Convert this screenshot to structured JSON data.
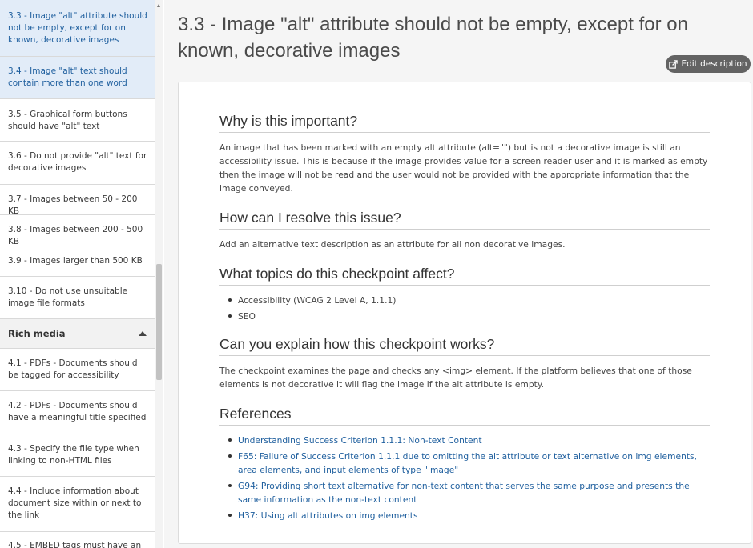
{
  "sidebar": {
    "items_top": [
      {
        "label": "3.3 - Image \"alt\" attribute should not be empty, except for on known, decorative images",
        "active": true
      },
      {
        "label": "3.4 - Image \"alt\" text should contain more than one word",
        "active": true
      },
      {
        "label": "3.5 - Graphical form buttons should have \"alt\" text",
        "active": false
      },
      {
        "label": "3.6 - Do not provide \"alt\" text for decorative images",
        "active": false
      },
      {
        "label": "3.7 - Images between 50 - 200 KB",
        "active": false
      },
      {
        "label": "3.8 - Images between 200 - 500 KB",
        "active": false
      },
      {
        "label": "3.9 - Images larger than 500 KB",
        "active": false
      },
      {
        "label": "3.10 - Do not use unsuitable image file formats",
        "active": false
      }
    ],
    "section": {
      "label": "Rich media",
      "icon": "caret-up-icon"
    },
    "items_bottom": [
      {
        "label": "4.1 - PDFs - Documents should be tagged for accessibility"
      },
      {
        "label": "4.2 - PDFs - Documents should have a meaningful title specified"
      },
      {
        "label": "4.3 - Specify the file type when linking to non-HTML files"
      },
      {
        "label": "4.4 - Include information about document size within or next to the link"
      },
      {
        "label": "4.5 - EMBED tags must have an"
      }
    ]
  },
  "main": {
    "title": "3.3 - Image \"alt\" attribute should not be empty, except for on known, decorative images",
    "edit_button": {
      "label": "Edit description",
      "icon": "external-edit-icon"
    },
    "sections": {
      "why": {
        "heading": "Why is this important?",
        "body": "An image that has been marked with an empty alt attribute (alt=\"\") but is not a decorative image is still an accessibility issue. This is because if the image provides value for a screen reader user and it is marked as empty then the image will not be read and the user would not be provided with the appropriate information that the image conveyed."
      },
      "resolve": {
        "heading": "How can I resolve this issue?",
        "body": "Add an alternative text description as an attribute for all non decorative images."
      },
      "topics": {
        "heading": "What topics do this checkpoint affect?",
        "items": [
          "Accessibility (WCAG 2 Level A, 1.1.1)",
          "SEO"
        ]
      },
      "explain": {
        "heading": "Can you explain how this checkpoint works?",
        "body": "The checkpoint examines the page and checks any <img> element. If the platform believes that one of those elements is not decorative it will flag the image if the alt attribute is empty."
      },
      "references": {
        "heading": "References",
        "links": [
          "Understanding Success Criterion 1.1.1: Non-text Content",
          "F65: Failure of Success Criterion 1.1.1 due to omitting the alt attribute or text alternative on img elements, area elements, and input elements of type \"image\"",
          "G94: Providing short text alternative for non-text content that serves the same purpose and presents the same information as the non-text content",
          "H37: Using alt attributes on img elements"
        ]
      }
    }
  },
  "colors": {
    "active_bg": "#e2ecf8",
    "link": "#1f5f9e",
    "button_bg": "#636363"
  }
}
